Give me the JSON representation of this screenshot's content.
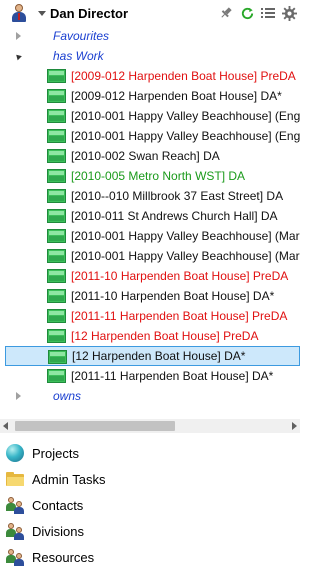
{
  "header": {
    "title": "Dan Director"
  },
  "tree": {
    "groups": {
      "favourites": "Favourites",
      "has_work": "has Work",
      "owns": "owns"
    },
    "items": [
      {
        "label": "[2009-012 Harpenden Boat House] PreDA",
        "color": "red"
      },
      {
        "label": "[2009-012 Harpenden Boat House] DA*",
        "color": "black"
      },
      {
        "label": "[2010-001 Happy Valley Beachhouse] (Engi",
        "color": "black"
      },
      {
        "label": "[2010-001 Happy Valley Beachhouse] (Engi",
        "color": "black"
      },
      {
        "label": "[2010-002 Swan Reach] DA",
        "color": "black"
      },
      {
        "label": "[2010-005 Metro North WST] DA",
        "color": "green"
      },
      {
        "label": "[2010--010 Millbrook 37 East Street] DA",
        "color": "black"
      },
      {
        "label": "[2010-011 St Andrews Church Hall] DA",
        "color": "black"
      },
      {
        "label": "[2010-001 Happy Valley Beachhouse] (Mar",
        "color": "black"
      },
      {
        "label": "[2010-001 Happy Valley Beachhouse] (Mar",
        "color": "black"
      },
      {
        "label": "[2011-10 Harpenden Boat House] PreDA",
        "color": "red"
      },
      {
        "label": "[2011-10 Harpenden Boat House] DA*",
        "color": "black"
      },
      {
        "label": "[2011-11 Harpenden Boat House] PreDA",
        "color": "red"
      },
      {
        "label": "[12 Harpenden Boat House] PreDA",
        "color": "red"
      },
      {
        "label": "[12 Harpenden Boat House] DA*",
        "color": "black",
        "selected": true
      },
      {
        "label": "[2011-11 Harpenden Boat House] DA*",
        "color": "black"
      }
    ]
  },
  "nav": {
    "items": [
      {
        "label": "Projects",
        "icon": "globe-icon"
      },
      {
        "label": "Admin Tasks",
        "icon": "folder-icon"
      },
      {
        "label": "Contacts",
        "icon": "people-icon"
      },
      {
        "label": "Divisions",
        "icon": "people-icon"
      },
      {
        "label": "Resources",
        "icon": "people-icon"
      }
    ]
  },
  "colors": {
    "group_link": "#1a3fd0",
    "status_red": "#e01010",
    "status_green": "#1a9a1a",
    "selection_bg": "#cde8fb",
    "selection_border": "#3c9ae0",
    "file_icon": "#3cbf5a"
  }
}
